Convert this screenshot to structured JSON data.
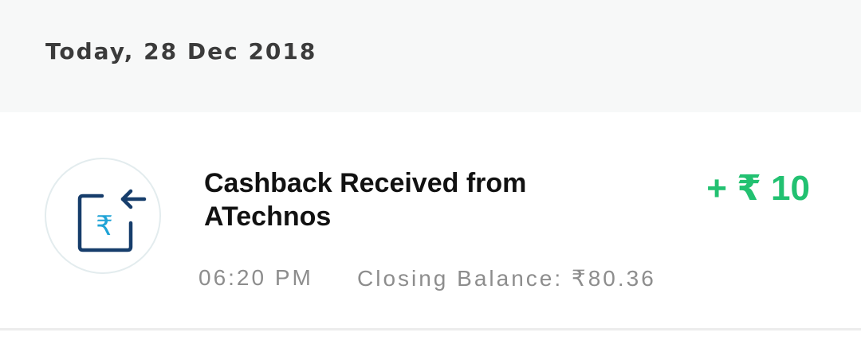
{
  "date_header": {
    "label": "Today, 28 Dec 2018"
  },
  "transaction": {
    "icon": "cashback-received-icon",
    "title": "Cashback Received from ATechnos",
    "amount": "+ ₹ 10",
    "time": "06:20 PM",
    "closing_balance": "Closing Balance: ₹80.36"
  },
  "colors": {
    "amount_positive": "#22c171",
    "icon_navy": "#163d6b",
    "icon_accent": "#1fa3d6",
    "header_bg": "#f7f8f8",
    "muted_text": "#8d8d8d"
  }
}
